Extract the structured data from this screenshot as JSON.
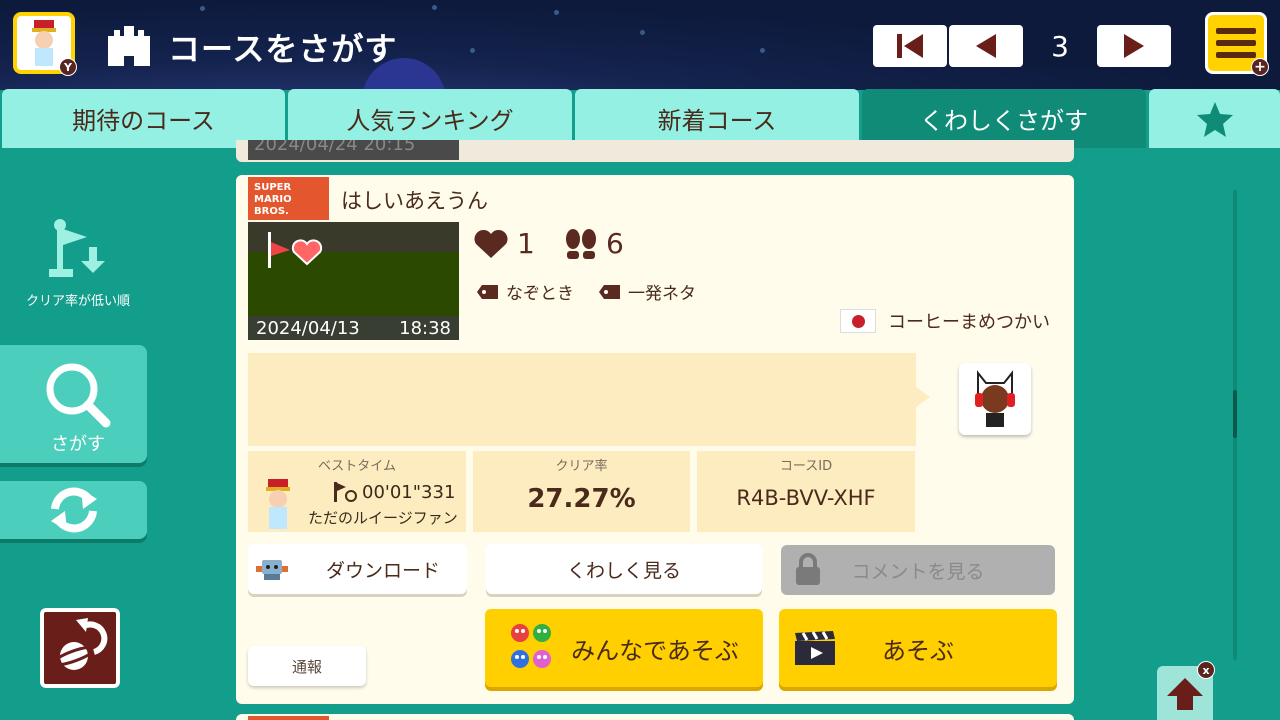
{
  "header": {
    "title": "コースをさがす",
    "avatar_badge": "Y",
    "page_number": "3",
    "menu_badge": "+"
  },
  "tabs": [
    {
      "label": "期待のコース"
    },
    {
      "label": "人気ランキング"
    },
    {
      "label": "新着コース"
    },
    {
      "label": "くわしくさがす"
    },
    {
      "label": "favorites-star-icon"
    }
  ],
  "sidebar": {
    "sort_label": "クリア率が低い順",
    "search_label": "さがす"
  },
  "previous_card": {
    "date": "2024/04/24   20:15"
  },
  "course": {
    "game_style": "SUPER MARIO BROS.",
    "title": "はしいあえうん",
    "upload_date": "2024/04/13",
    "upload_time": "18:38",
    "likes": "1",
    "plays": "6",
    "tags": [
      "なぞとき",
      "一発ネタ"
    ],
    "maker": "コーヒーまめつかい",
    "maker_country": "JP",
    "description": "",
    "best_time_label": "ベストタイム",
    "best_time": "00'01\"331",
    "best_time_holder": "ただのルイージファン",
    "clear_rate_label": "クリア率",
    "clear_rate": "27.27%",
    "course_id_label": "コースID",
    "course_id": "R4B-BVV-XHF"
  },
  "buttons": {
    "download": "ダウンロード",
    "details": "くわしく見る",
    "comments": "コメントを見る",
    "report": "通報",
    "multiplayer": "みんなであそぶ",
    "play": "あそぶ"
  },
  "badges": {
    "close": "x"
  },
  "colors": {
    "background": "#139e8c",
    "header_bg": "#0d1a3c",
    "tab_inactive": "#93f0e3",
    "tab_active": "#108b78",
    "accent_yellow": "#ffcf00",
    "card_bg": "#fffcec",
    "info_bg": "#fdecc0"
  }
}
